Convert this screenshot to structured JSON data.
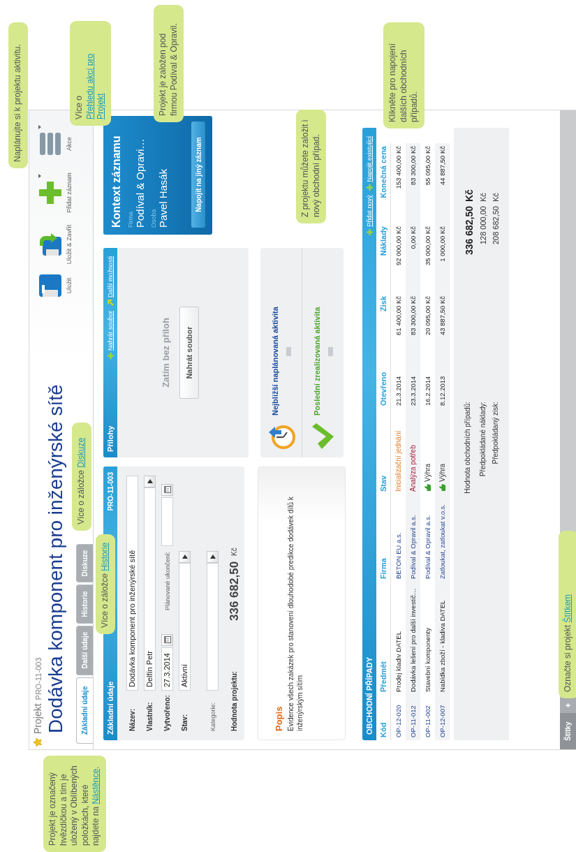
{
  "header": {
    "type_label": "Projekt",
    "code": "PRO-11-003",
    "title": "Dodávka komponent pro inženýrské sítě",
    "favorite": true
  },
  "tabs": [
    {
      "label": "Základní údaje",
      "selected": true
    },
    {
      "label": "Další údaje",
      "selected": false
    },
    {
      "label": "Historie",
      "selected": false
    },
    {
      "label": "Diskuze",
      "selected": false
    }
  ],
  "toolbar": [
    {
      "kind": "save",
      "label": "Uložit",
      "menu": false
    },
    {
      "kind": "save_close",
      "label": "Uložit & Zavřít",
      "menu": false
    },
    {
      "kind": "add",
      "label": "Přidat záznam",
      "menu": true
    },
    {
      "kind": "actions",
      "label": "Akce",
      "menu": true
    }
  ],
  "basic": {
    "title": "Základní údaje",
    "code": "PRO-11-003",
    "fields": [
      {
        "kind": "text",
        "label": "Název:",
        "required": true,
        "value": "Dodávka komponent pro inženýrské sítě"
      },
      {
        "kind": "lookup",
        "label": "Vlastník:",
        "required": true,
        "value": "Delfín Petr"
      },
      {
        "kind": "date",
        "label": "Vytvořeno:",
        "required": true,
        "value": "27.3.2014",
        "second_label": "Plánované ukončení:"
      },
      {
        "kind": "select",
        "label": "Stav:",
        "required": true,
        "value": "Aktivní"
      },
      {
        "kind": "select",
        "label": "Kategorie:",
        "required": false
      },
      {
        "kind": "money",
        "label": "Hodnota projektu:",
        "required": true,
        "value": "336 682,50",
        "currency": "Kč"
      }
    ]
  },
  "description": {
    "title": "Popis",
    "text": "Evidence všech zakázek pro stanovení dlouhodobé predikce dodávek dílů k inženýrským sítím"
  },
  "attachments": {
    "title": "Přílohy",
    "links": [
      {
        "kind": "upload",
        "label": "Nahrát soubor"
      },
      {
        "kind": "more",
        "label": "Další možnosti"
      }
    ],
    "empty_text": "Zatím bez příloh",
    "button": "Nahrát soubor"
  },
  "activities": [
    {
      "kind": "planned",
      "title": "Nejbližší naplánovaná aktivita"
    },
    {
      "kind": "done",
      "title": "Poslední zrealizovaná aktivita"
    }
  ],
  "context": {
    "title": "Kontext záznamu",
    "items": [
      {
        "label": "Firma",
        "value": "Podíval & Opravi…"
      },
      {
        "label": "Osoba",
        "value": "Pavel Hasák"
      }
    ],
    "button": "Napojit na jiný záznam"
  },
  "deals": {
    "title": "OBCHODNÍ PŘÍPADY",
    "links": [
      "Přidat nový",
      "Napojit existující"
    ],
    "columns": [
      "Kód",
      "Předmět",
      "Firma",
      "Stav",
      "Otevřeno",
      "Zisk",
      "Náklady",
      "Konečná cena"
    ],
    "rows": [
      {
        "code": "OP-12-020",
        "subject": "Prodej kladiv DATEL",
        "company": "BETON EU a.s.",
        "status": {
          "text": "Inicializační jednání",
          "color": "#e07b24",
          "won": false
        },
        "opened": "21.3.2014",
        "profit": "61 400,00 Kč",
        "costs": "92 000,00 Kč",
        "price": "153 400,00 Kč"
      },
      {
        "code": "OP-11-012",
        "subject": "Dodávka lešení pro další investič…",
        "company": "Podíval & Opravil a.s.",
        "status": {
          "text": "Analýza potřeb",
          "color": "#a3203c",
          "won": false
        },
        "opened": "23.3.2014",
        "profit": "83 300,00 Kč",
        "costs": "0,00 Kč",
        "price": "83 300,00 Kč"
      },
      {
        "code": "OP-11-002",
        "subject": "Stavební komponenty",
        "company": "Podíval & Opravil a.s.",
        "status": {
          "text": "Výhra",
          "won": true
        },
        "opened": "16.2.2014",
        "profit": "20 095,00 Kč",
        "costs": "35 000,00 Kč",
        "price": "55 095,00 Kč"
      },
      {
        "code": "OP-12-007",
        "subject": "Nabídka zboží - kladiva DATEL",
        "company": "Zatloukat, zatloukat v.o.s.",
        "status": {
          "text": "Výhra",
          "won": true
        },
        "opened": "8.12.2013",
        "profit": "43 887,50 Kč",
        "costs": "1 000,00 Kč",
        "price": "44 887,50 Kč"
      }
    ],
    "totals": [
      {
        "kind": "main",
        "label": "Hodnota obchodních případů:",
        "value": "336 682,50",
        "currency": "Kč"
      },
      {
        "kind": "sub",
        "label": "Předpokládané náklady:",
        "value": "128 000,00",
        "currency": "Kč"
      },
      {
        "kind": "sub",
        "label": "Předpokládaný zisk:",
        "value": "208 682,50",
        "currency": "Kč"
      }
    ]
  },
  "tags_bar": {
    "tab": "Štítky",
    "add": "+"
  },
  "callouts": [
    {
      "before": "Projekt je označený hvězdičkou a tím je uložený v Oblíbených položkách, které najdete na ",
      "link": "Nástěnce",
      "after": "."
    },
    {
      "before": "Více o záložce ",
      "link": "Historie"
    },
    {
      "before": "Více o záložce ",
      "link": "Diskuze"
    },
    {
      "before": "Naplánujte si k projektu aktivitu."
    },
    {
      "before": "Více o ",
      "link": "Přehledu akcí pro Projekt"
    },
    {
      "before": "Projekt je založen pod firmou Podíval & Opravil."
    },
    {
      "before": "Z projektu můžete založit i nový obchodní případ."
    },
    {
      "before": "Klikněte pro napojení dalších obchodních případů."
    },
    {
      "before": "Označte si projekt ",
      "link": "Štítkem"
    }
  ]
}
